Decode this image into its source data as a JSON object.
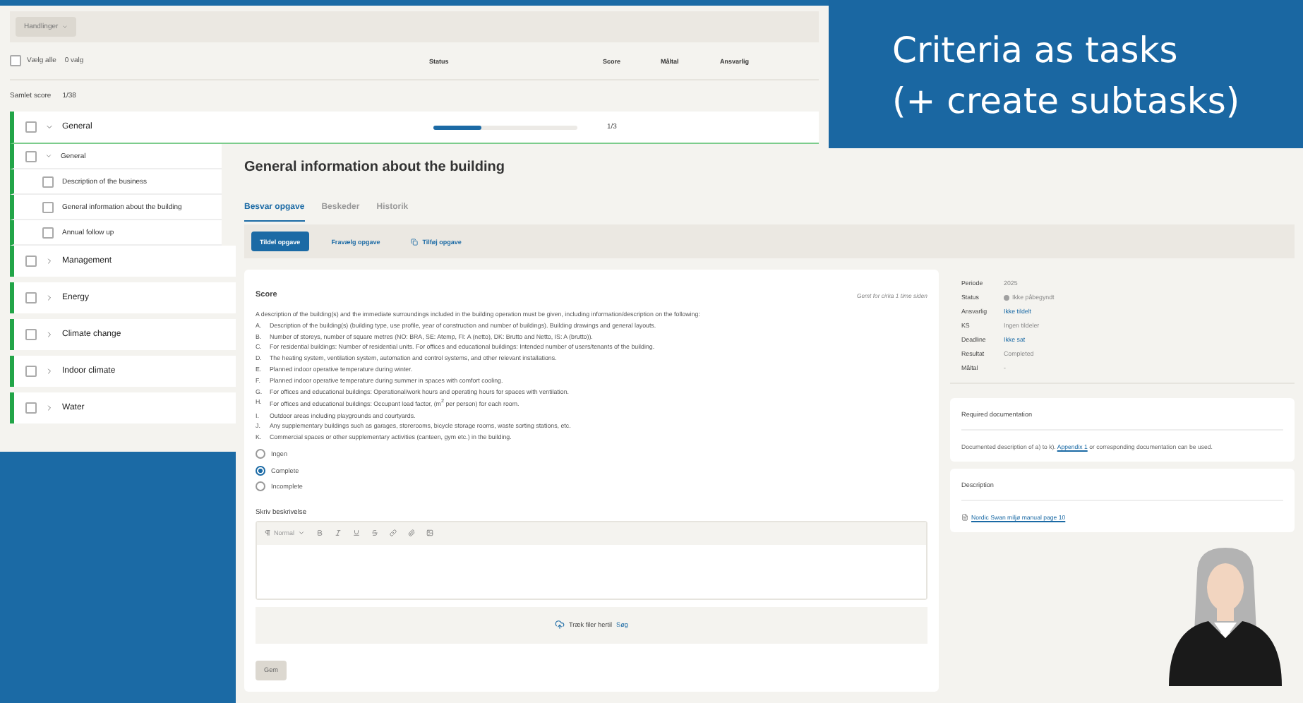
{
  "slide": {
    "title_lines": [
      "Criteria as tasks",
      "(+ create subtasks)"
    ]
  },
  "task_list": {
    "actions_button": "Handlinger",
    "select_all": {
      "label": "Vælg alle",
      "checked": false
    },
    "selected_count": "0 valg",
    "columns": [
      "Status",
      "Score",
      "Måltal",
      "Ansvarlig"
    ],
    "total": {
      "label": "Samlet score",
      "value": "1/38"
    },
    "groups": [
      {
        "name": "General",
        "expanded": true,
        "checked": false,
        "level": 0.33,
        "score": "1/3",
        "children": [
          {
            "name": "General",
            "expanded": true,
            "checked": false,
            "children": [
              {
                "name": "Description of the business",
                "checked": false
              },
              {
                "name": "General information about the building",
                "checked": false
              },
              {
                "name": "Annual follow up",
                "checked": false
              }
            ]
          }
        ]
      },
      {
        "name": "Management",
        "expanded": false,
        "checked": false
      },
      {
        "name": "Energy",
        "expanded": false,
        "checked": false
      },
      {
        "name": "Climate change",
        "expanded": false,
        "checked": false
      },
      {
        "name": "Indoor climate",
        "expanded": false,
        "checked": false
      },
      {
        "name": "Water",
        "expanded": false,
        "checked": false
      }
    ]
  },
  "task": {
    "title": "General information about the building",
    "tabs": [
      {
        "label": "Besvar opgave",
        "selected": true
      },
      {
        "label": "Beskeder",
        "selected": false
      },
      {
        "label": "Historik",
        "selected": false
      }
    ],
    "actions": [
      {
        "label": "Tildel opgave",
        "kind": "primary"
      },
      {
        "label": "Fravælg opgave",
        "kind": "link"
      },
      {
        "label": "Tilføj opgave",
        "kind": "icon-link"
      }
    ],
    "score_card": {
      "heading": "Score",
      "saved": "Gemt for cirka 1 time siden",
      "intro": "A description of the building(s) and the immediate surroundings included in the building operation must be given, including information/description on the following:",
      "items": [
        {
          "marker": "A.",
          "text": "Description of the building(s) (building type, use profile, year of construction and number of buildings). Building drawings and general layouts."
        },
        {
          "marker": "B.",
          "text": "Number of storeys, number of square metres (NO: BRA, SE: Atemp, FI: A (netto), DK: Brutto and Netto, IS: A (brutto))."
        },
        {
          "marker": "C.",
          "text": "For residential buildings: Number of residential units. For offices and educational buildings: Intended number of users/tenants of the building."
        },
        {
          "marker": "D.",
          "text": "The heating system, ventilation system, automation and control systems, and other relevant installations."
        },
        {
          "marker": "E.",
          "text": "Planned indoor operative temperature during winter."
        },
        {
          "marker": "F.",
          "text": "Planned indoor operative temperature during summer in spaces with comfort cooling."
        },
        {
          "marker": "G.",
          "text": "For offices and educational buildings: Operational/work hours and operating hours for spaces with ventilation."
        },
        {
          "marker": "H.",
          "text": "For offices and educational buildings: Occupant load factor, (m$^{2}$ per person) for each room."
        },
        {
          "marker": "I.",
          "text": "Outdoor areas including playgrounds and courtyards."
        },
        {
          "marker": "J.",
          "text": "Any supplementary buildings such as garages, storerooms, bicycle storage rooms, waste sorting stations, etc."
        },
        {
          "marker": "K.",
          "text": "Commercial spaces or other supplementary activities (canteen, gym etc.) in the building."
        }
      ],
      "options": [
        {
          "label": "Ingen",
          "selected": false
        },
        {
          "label": "Complete",
          "selected": true
        },
        {
          "label": "Incomplete",
          "selected": false
        }
      ],
      "editor_label": "Skriv beskrivelse",
      "format": "Normal",
      "dropzone": {
        "text": "Træk filer hertil",
        "link": "Søg"
      },
      "save_button": "Gem"
    },
    "meta": [
      {
        "label": "Periode",
        "value": "2025",
        "kind": "text"
      },
      {
        "label": "Status",
        "value": "Ikke påbegyndt",
        "kind": "status",
        "color": "#a0a0a0"
      },
      {
        "label": "Ansvarlig",
        "value": "Ikke tildelt",
        "kind": "link"
      },
      {
        "label": "KS",
        "value": "Ingen tildeler",
        "kind": "text"
      },
      {
        "label": "Deadline",
        "value": "Ikke sat",
        "kind": "link"
      },
      {
        "label": "Resultat",
        "value": "Completed",
        "kind": "text"
      },
      {
        "label": "Måltal",
        "value": "-",
        "kind": "text"
      }
    ],
    "required_doc": {
      "heading": "Required documentation",
      "before": "Documented description of a) to k).",
      "link": "Appendix 1",
      "after": "or corresponding documentation can be used."
    },
    "description": {
      "heading": "Description",
      "link": "Nordic Swan miljø manual page 10"
    }
  }
}
